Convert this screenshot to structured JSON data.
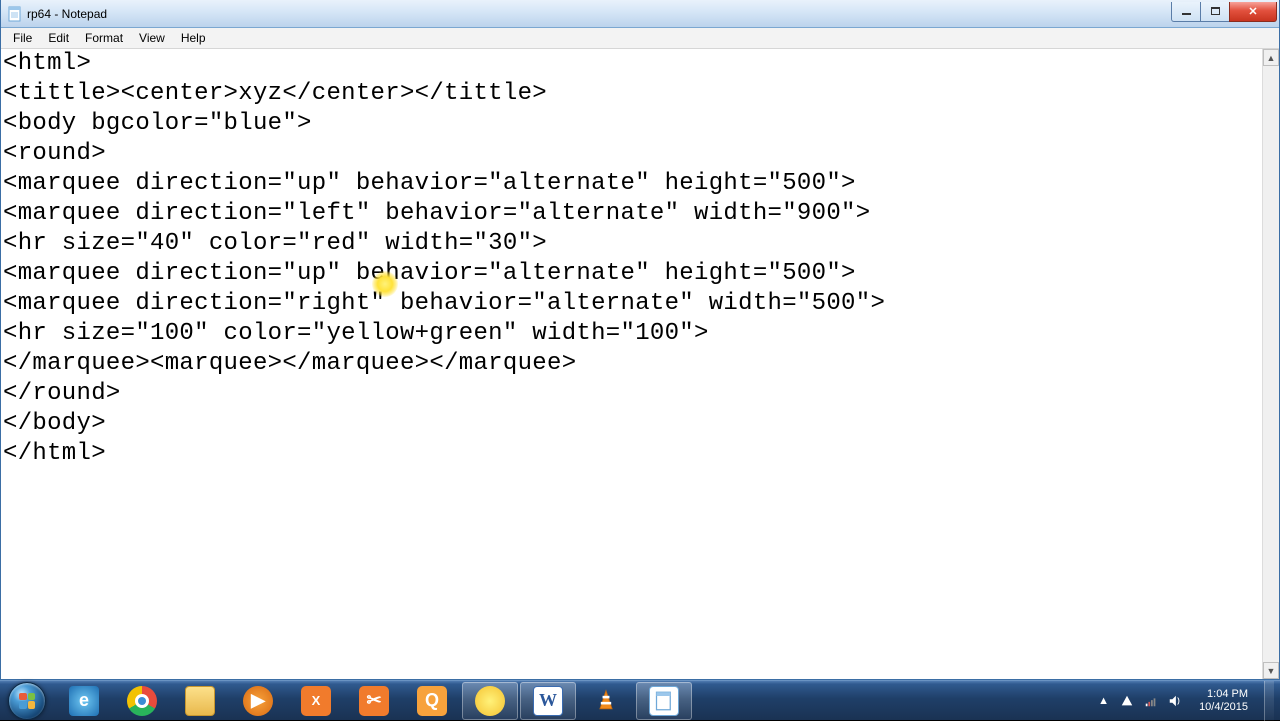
{
  "window": {
    "title": "rp64 - Notepad"
  },
  "menu": {
    "file": "File",
    "edit": "Edit",
    "format": "Format",
    "view": "View",
    "help": "Help"
  },
  "editor": {
    "content": "<html>\n<tittle><center>xyz</center></tittle>\n<body bgcolor=\"blue\">\n<round>\n<marquee direction=\"up\" behavior=\"alternate\" height=\"500\">\n<marquee direction=\"left\" behavior=\"alternate\" width=\"900\">\n<hr size=\"40\" color=\"red\" width=\"30\">\n<marquee direction=\"up\" behavior=\"alternate\" height=\"500\">\n<marquee direction=\"right\" behavior=\"alternate\" width=\"500\">\n<hr size=\"100\" color=\"yellow+green\" width=\"100\">\n</marquee><marquee></marquee></marquee>\n</round>\n</body>\n</html>"
  },
  "taskbar": {
    "items": [
      {
        "name": "start",
        "label": "Start"
      },
      {
        "name": "ie",
        "label": "Internet Explorer"
      },
      {
        "name": "chrome",
        "label": "Google Chrome"
      },
      {
        "name": "explorer",
        "label": "File Explorer"
      },
      {
        "name": "wmp",
        "label": "Windows Media Player"
      },
      {
        "name": "xampp",
        "label": "XAMPP"
      },
      {
        "name": "snip",
        "label": "Snipping Tool"
      },
      {
        "name": "app-orange",
        "label": "App"
      },
      {
        "name": "app-cursor",
        "label": "Cursor Highlighter"
      },
      {
        "name": "word",
        "label": "Microsoft Word"
      },
      {
        "name": "vlc",
        "label": "VLC media player"
      },
      {
        "name": "notepad",
        "label": "Notepad"
      }
    ]
  },
  "tray": {
    "show_hidden": "▲",
    "time": "1:04 PM",
    "date": "10/4/2015"
  }
}
